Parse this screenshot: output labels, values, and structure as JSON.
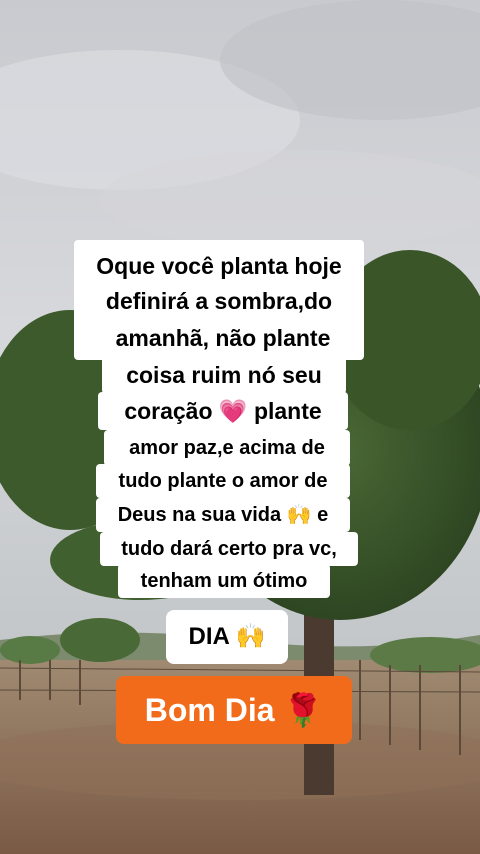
{
  "caption": {
    "lines": [
      "Oque você planta hoje",
      "definirá a sombra,do",
      "amanhã, não plante",
      "coisa ruim nó seu",
      "coração 💗 plante",
      "amor paz,e acima de",
      "tudo plante o amor de",
      "Deus na sua vida 🙌 e",
      "tudo dará certo pra vc,",
      "tenham um ótimo",
      "DIA 🙌"
    ]
  },
  "sticker": {
    "label": "Bom Dia 🌹",
    "color": "#f26b1a"
  },
  "scene": {
    "sky_color": "#cfd0d5",
    "ground_color": "#8a6a52",
    "tree_color": "#3e5a2e"
  }
}
